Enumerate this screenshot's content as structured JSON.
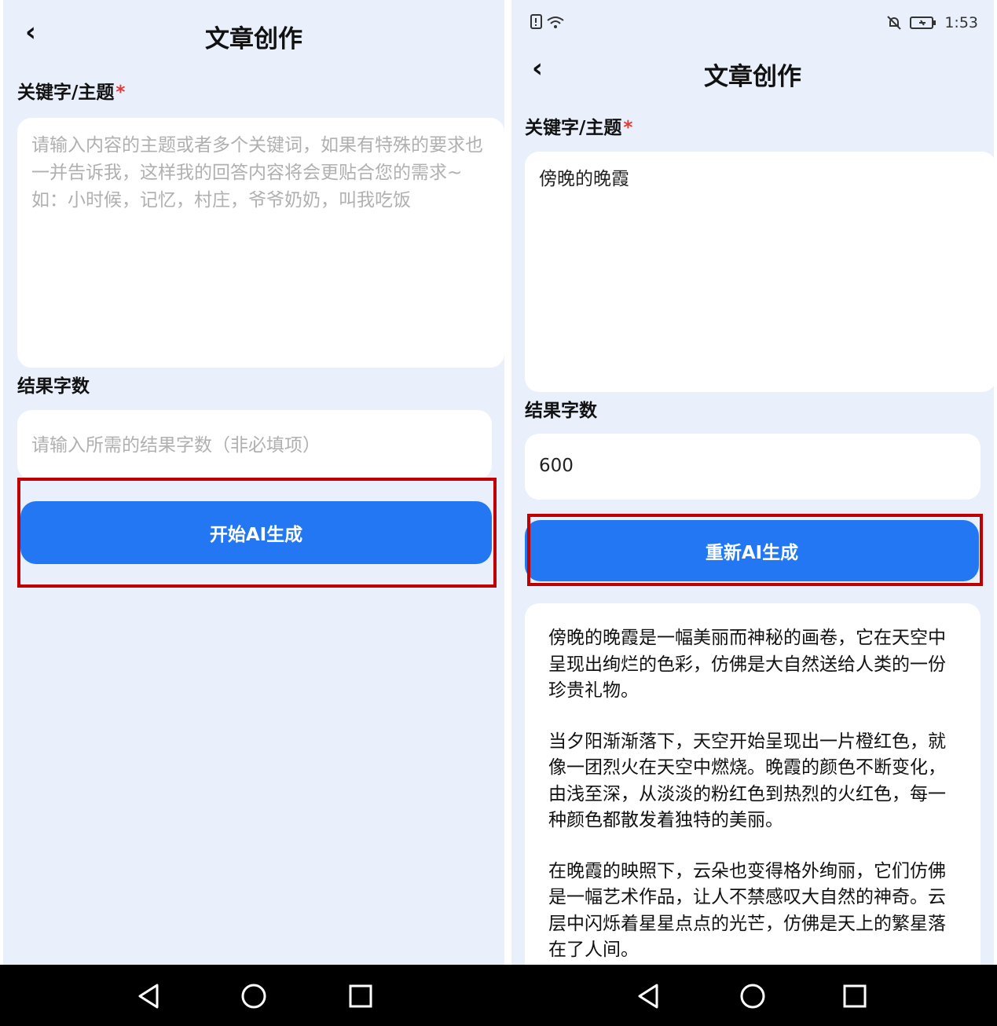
{
  "left": {
    "header": {
      "back_icon": "chevron-left-icon",
      "title": "文章创作"
    },
    "keyword": {
      "label": "关键字/主题",
      "required_mark": "*",
      "placeholder": "请输入内容的主题或者多个关键词，如果有特殊的要求也一并告诉我，这样我的回答内容将会更贴合您的需求~\n如：小时候，记忆，村庄，爷爷奶奶，叫我吃饭"
    },
    "word_count": {
      "label": "结果字数",
      "placeholder": "请输入所需的结果字数（非必填项）"
    },
    "generate_button": "开始AI生成"
  },
  "right": {
    "status_bar": {
      "time": "1:53",
      "left_icons": [
        "sim-icon",
        "wifi-icon"
      ],
      "right_icons": [
        "mute-bell-icon",
        "battery-charging-icon"
      ]
    },
    "header": {
      "back_icon": "chevron-left-icon",
      "title": "文章创作"
    },
    "keyword": {
      "label": "关键字/主题",
      "required_mark": "*",
      "value": "傍晚的晚霞"
    },
    "word_count": {
      "label": "结果字数",
      "value": "600"
    },
    "regenerate_button": "重新AI生成",
    "result": {
      "paragraphs": [
        "傍晚的晚霞是一幅美丽而神秘的画卷，它在天空中呈现出绚烂的色彩，仿佛是大自然送给人类的一份珍贵礼物。",
        "当夕阳渐渐落下，天空开始呈现出一片橙红色，就像一团烈火在天空中燃烧。晚霞的颜色不断变化，由浅至深，从淡淡的粉红色到热烈的火红色，每一种颜色都散发着独特的美丽。",
        "在晚霞的映照下，云朵也变得格外绚丽，它们仿佛是一幅艺术作品，让人不禁感叹大自然的神奇。云层中闪烁着星星点点的光芒，仿佛是天上的繁星落在了人间。"
      ]
    }
  },
  "nav": {
    "icons": [
      "back-triangle-icon",
      "home-circle-icon",
      "recents-square-icon"
    ]
  },
  "colors": {
    "accent": "#2377f3",
    "background": "#e9f0fc",
    "highlight": "#c00000",
    "required": "#e53935"
  }
}
